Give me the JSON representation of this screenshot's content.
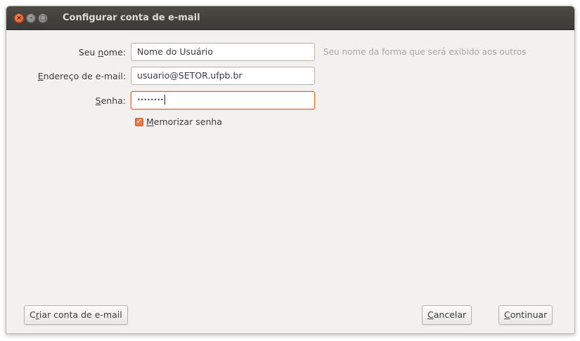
{
  "window": {
    "title": "Configurar conta de e-mail",
    "accent_color": "#e0662e"
  },
  "form": {
    "name_label_pre": "Seu ",
    "name_label_u": "n",
    "name_label_post": "ome:",
    "name_value": "Nome do Usuário",
    "name_hint": "Seu nome da forma que será exibido aos outros",
    "email_label_u": "E",
    "email_label_post": "ndereço de e-mail:",
    "email_value": "usuario@SETOR.ufpb.br",
    "password_label_u": "S",
    "password_label_post": "enha:",
    "password_value": "••••••••",
    "remember_label_u": "M",
    "remember_label_post": "emorizar senha",
    "remember_checked": true
  },
  "buttons": {
    "create_account_pre": "C",
    "create_account_u": "r",
    "create_account_post": "iar conta de e-mail",
    "cancel_u": "C",
    "cancel_post": "ancelar",
    "continue_u": "C",
    "continue_post": "ontinuar"
  },
  "icons": {
    "close": "close-icon",
    "minimize": "minimize-icon",
    "maximize": "maximize-icon",
    "checkbox": "checkmark-icon"
  }
}
